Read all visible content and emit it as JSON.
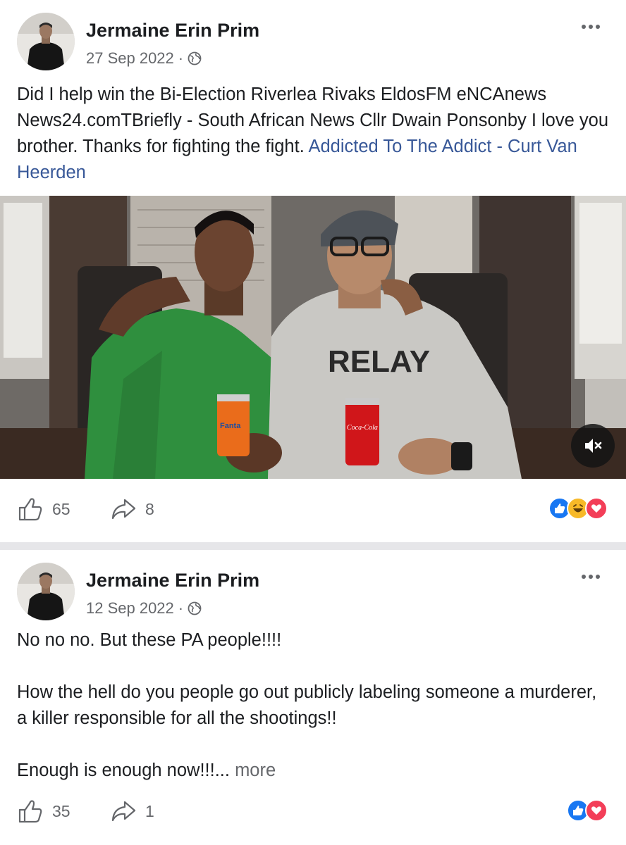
{
  "posts": [
    {
      "author": "Jermaine Erin Prim",
      "date": "27 Sep 2022",
      "separator": "·",
      "text": "Did I help win the Bi-Election Riverlea Rivaks EldosFM eNCAnews News24.comTBriefly - South African News Cllr Dwain Ponsonby I love you brother. Thanks for fighting the fight. ",
      "link_text": "Addicted To The Addict - Curt Van Heerden",
      "video": {
        "can_left_text": "Fanta",
        "can_right_text": "Coca-Cola",
        "shirt_text": "RELAY"
      },
      "likes": "65",
      "shares": "8",
      "reactions": [
        "like",
        "haha",
        "love"
      ]
    },
    {
      "author": "Jermaine Erin Prim",
      "date": "12 Sep 2022",
      "separator": "·",
      "paragraphs": [
        "No no no. But these PA people!!!!",
        "How the hell do you people go out publicly labeling someone a murderer, a killer responsible for all the shootings!!",
        "Enough is enough now!!!... "
      ],
      "more_label": "more",
      "likes": "35",
      "shares": "1",
      "reactions": [
        "like",
        "love"
      ]
    }
  ],
  "icons": {
    "avatar": "avatar",
    "globe": "globe-icon",
    "more": "more-options-icon",
    "like": "thumbs-up-icon",
    "share": "share-icon",
    "mute": "muted-speaker-icon"
  },
  "colors": {
    "link": "#385898",
    "secondary_text": "#65676b",
    "like_blue": "#1877f2",
    "love_red": "#f33e58",
    "haha_yellow": "#f7b928"
  }
}
